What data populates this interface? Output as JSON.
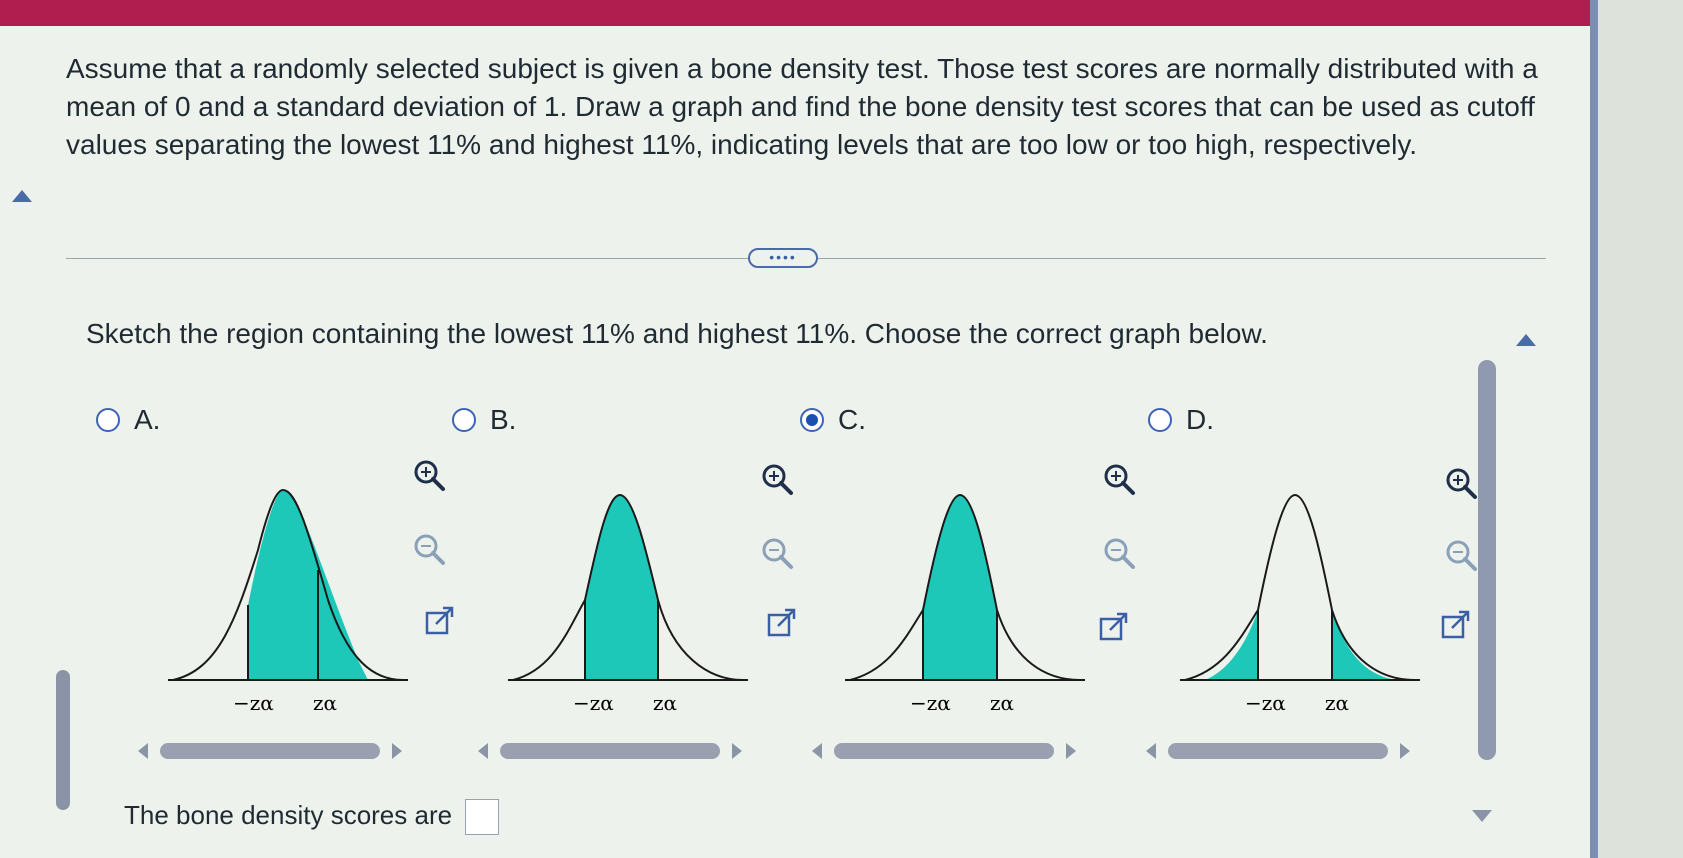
{
  "question_text": "Assume that a randomly selected subject is given a bone density test. Those test scores are normally distributed with a mean of 0 and a standard deviation of 1. Draw a graph and find the bone density test scores that can be used as cutoff values separating the lowest 11% and highest 11%, indicating levels that are too low or too high, respectively.",
  "more_button_label": "••••",
  "prompt_text": "Sketch the region containing the lowest 11% and highest 11%. Choose the correct graph below.",
  "options": [
    {
      "label": "A.",
      "selected": false,
      "shading": "left-center"
    },
    {
      "label": "B.",
      "selected": false,
      "shading": "center"
    },
    {
      "label": "C.",
      "selected": true,
      "shading": "center"
    },
    {
      "label": "D.",
      "selected": false,
      "shading": "tails"
    }
  ],
  "graph_labels": {
    "neg": "−zα",
    "pos": "zα"
  },
  "answer_label": "The bone density scores are",
  "answer_value": "",
  "colors": {
    "accent_bar": "#b01e50",
    "fill": "#1ec8b8",
    "radio": "#1b4fb0",
    "link": "#3b5fa5"
  },
  "icons": [
    "zoom-in-icon",
    "zoom-out-icon",
    "popout-icon"
  ]
}
